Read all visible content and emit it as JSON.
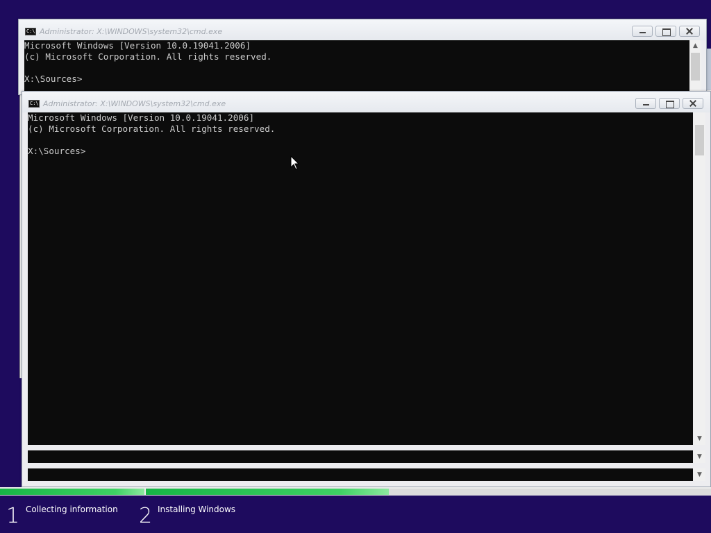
{
  "windows": [
    {
      "title": "Administrator: X:\\WINDOWS\\system32\\cmd.exe",
      "lines": [
        "Microsoft Windows [Version 10.0.19041.2006]",
        "(c) Microsoft Corporation. All rights reserved.",
        "",
        "X:\\Sources>"
      ]
    },
    {
      "title": "Administrator: X:\\WINDOWS\\system32\\cmd.exe",
      "lines": [
        "Microsoft Windows [Version 10.0.19041.2006]",
        "(c) Microsoft Corporation. All rights reserved.",
        "",
        "X:\\Sources>"
      ]
    }
  ],
  "icons": {
    "console": "cmd-icon",
    "minimize": "minimize-icon",
    "maximize": "maximize-icon",
    "close": "close-icon",
    "scroll_up": "▲",
    "scroll_down": "▼",
    "console_icon_text": "C:\\"
  },
  "setup": {
    "steps": [
      {
        "number": "1",
        "label": "Collecting information",
        "progress": 1.0
      },
      {
        "number": "2",
        "label": "Installing Windows",
        "progress": 0.43
      }
    ]
  },
  "colors": {
    "background": "#1e0b5e",
    "progress": "#2cc456",
    "console_bg": "#0c0c0c",
    "console_fg": "#cccccc"
  }
}
